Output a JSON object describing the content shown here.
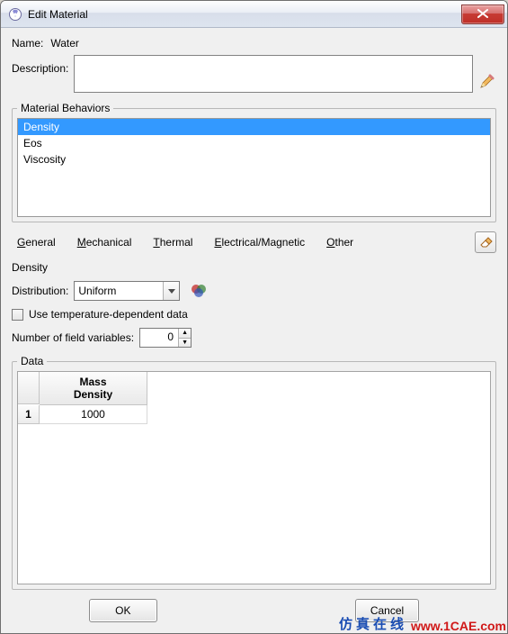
{
  "titlebar": {
    "title": "Edit Material"
  },
  "nameLabel": "Name:",
  "nameValue": "Water",
  "descLabel": "Description:",
  "behaviorsLegend": "Material Behaviors",
  "behaviors": {
    "items": [
      "Density",
      "Eos",
      "Viscosity"
    ],
    "selected": 0
  },
  "menu": {
    "general": "General",
    "mechanical": "Mechanical",
    "thermal": "Thermal",
    "electrical": "Electrical/Magnetic",
    "other": "Other"
  },
  "section": {
    "title": "Density",
    "distLabel": "Distribution:",
    "distValue": "Uniform",
    "tempDep": "Use temperature-dependent data",
    "fieldVarsLabel": "Number of field variables:",
    "fieldVarsValue": "0"
  },
  "dataLegend": "Data",
  "grid": {
    "colHeader": "Mass\nDensity",
    "rowNum": "1",
    "cell": "1000"
  },
  "buttons": {
    "ok": "OK",
    "cancel": "Cancel"
  },
  "watermark": {
    "cn": "仿真在线",
    "url": "www.1CAE.com"
  }
}
